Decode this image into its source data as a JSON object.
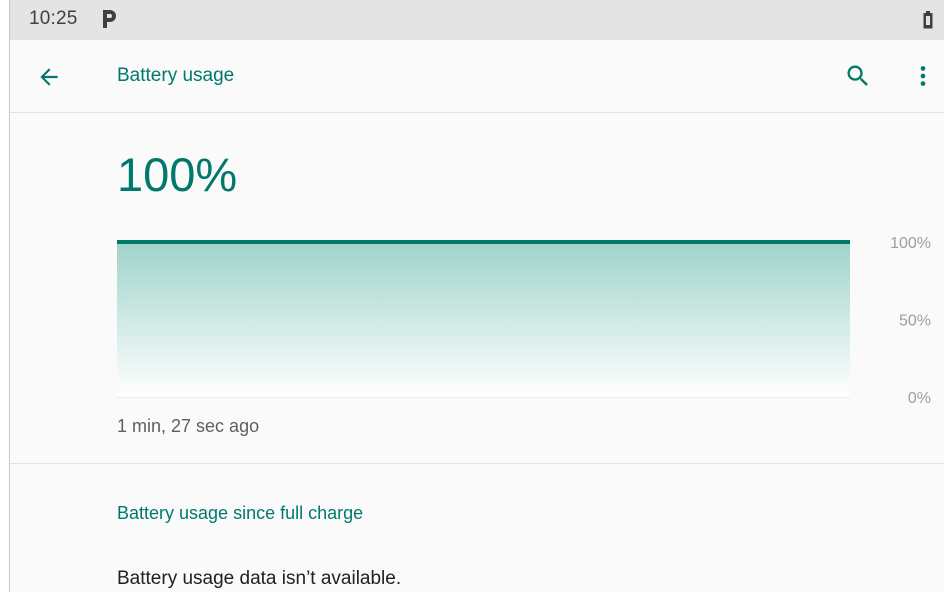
{
  "status_bar": {
    "time": "10:25",
    "notification_icon": "parking-p-icon",
    "battery_icon": "battery-icon"
  },
  "app_bar": {
    "back_icon": "arrow-left-icon",
    "title": "Battery usage",
    "search_icon": "search-icon",
    "more_icon": "more-vert-icon"
  },
  "battery": {
    "level": "100%",
    "last_updated": "1 min, 27 sec ago"
  },
  "chart_data": {
    "type": "area",
    "title": "",
    "xlabel": "",
    "ylabel": "",
    "ylim": [
      0,
      100
    ],
    "ytick_labels": [
      "100%",
      "50%",
      "0%"
    ],
    "series": [
      {
        "values": [
          100,
          100
        ]
      }
    ],
    "grid": true
  },
  "usage_section": {
    "title": "Battery usage since full charge",
    "empty_message": "Battery usage data isn’t available."
  },
  "colors": {
    "accent": "#00796b",
    "status_bar_bg": "#e4e4e4",
    "background": "#fafafa"
  }
}
